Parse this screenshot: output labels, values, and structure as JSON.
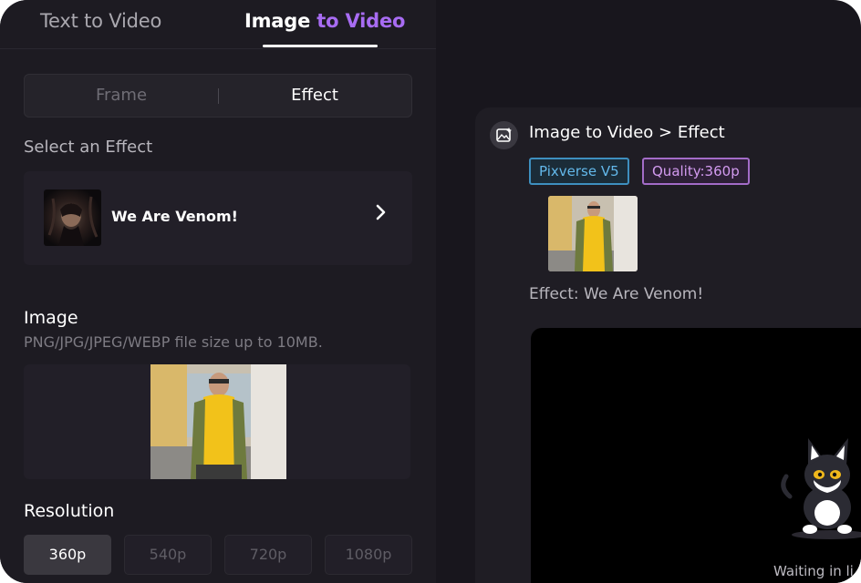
{
  "tabs": {
    "text_to_video": "Text to Video",
    "image_to_video_part1": "Image",
    "image_to_video_part2": "to Video"
  },
  "mode_toggle": {
    "frame": "Frame",
    "effect": "Effect",
    "selected": "Effect"
  },
  "effect_section": {
    "label": "Select an Effect",
    "selected_effect": "We Are Venom!"
  },
  "image_section": {
    "label": "Image",
    "hint": "PNG/JPG/JPEG/WEBP file size up to 10MB."
  },
  "resolution": {
    "label": "Resolution",
    "options": [
      "360p",
      "540p",
      "720p",
      "1080p"
    ],
    "selected": "360p"
  },
  "task": {
    "title": "Image to Video > Effect",
    "model_tag": "Pixverse V5",
    "quality_tag": "Quality:360p",
    "effect_line": "Effect: We Are Venom!",
    "waiting_text": "Waiting in li"
  },
  "colors": {
    "accent_purple": "#a86cf3",
    "model_tag": "#63b8ea",
    "quality_tag": "#d39bf0",
    "background": "#18161d"
  },
  "icons": [
    "chevron-right-icon",
    "image-sparkle-icon",
    "cat-mascot-icon"
  ]
}
